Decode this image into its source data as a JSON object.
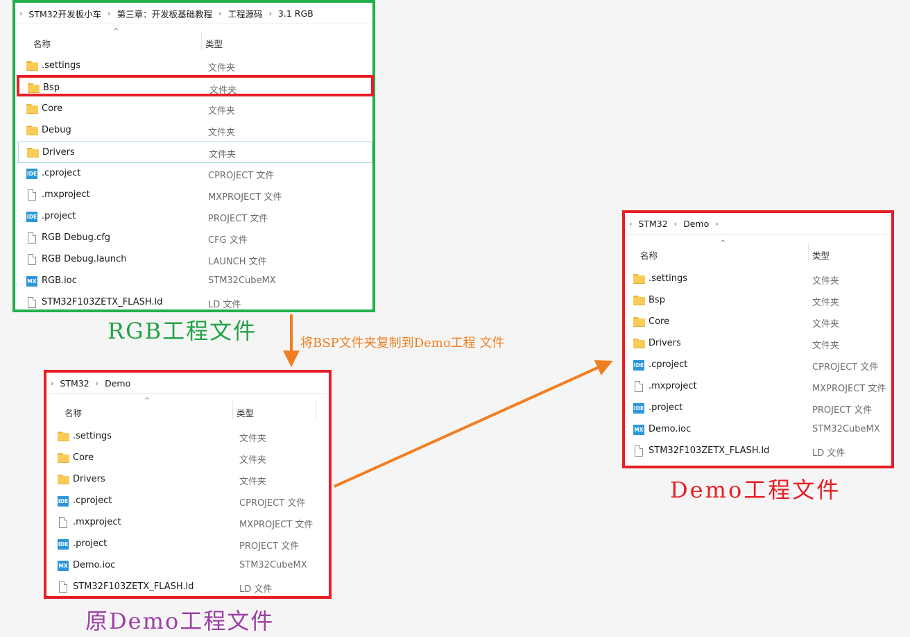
{
  "panel_rgb": {
    "breadcrumb": [
      "STM32开发板小车",
      "第三章：开发板基础教程",
      "工程源码",
      "3.1 RGB"
    ],
    "columns": {
      "name": "名称",
      "type": "类型"
    },
    "files": [
      {
        "name": ".settings",
        "type": "文件夹",
        "icon": "folder-icon"
      },
      {
        "name": "Bsp",
        "type": "文件夹",
        "icon": "folder-icon"
      },
      {
        "name": "Core",
        "type": "文件夹",
        "icon": "folder-icon"
      },
      {
        "name": "Debug",
        "type": "文件夹",
        "icon": "folder-icon"
      },
      {
        "name": "Drivers",
        "type": "文件夹",
        "icon": "folder-icon"
      },
      {
        "name": ".cproject",
        "type": "CPROJECT 文件",
        "icon": "ide-file-icon"
      },
      {
        "name": ".mxproject",
        "type": "MXPROJECT 文件",
        "icon": "file-icon"
      },
      {
        "name": ".project",
        "type": "PROJECT 文件",
        "icon": "ide-file-icon"
      },
      {
        "name": "RGB Debug.cfg",
        "type": "CFG 文件",
        "icon": "file-icon"
      },
      {
        "name": "RGB Debug.launch",
        "type": "LAUNCH 文件",
        "icon": "file-icon"
      },
      {
        "name": "RGB.ioc",
        "type": "STM32CubeMX",
        "icon": "mx-file-icon"
      },
      {
        "name": "STM32F103ZETX_FLASH.ld",
        "type": "LD 文件",
        "icon": "file-icon"
      }
    ]
  },
  "panel_orig": {
    "breadcrumb": [
      "STM32",
      "Demo"
    ],
    "columns": {
      "name": "名称",
      "type": "类型"
    },
    "files": [
      {
        "name": ".settings",
        "type": "文件夹",
        "icon": "folder-icon"
      },
      {
        "name": "Core",
        "type": "文件夹",
        "icon": "folder-icon"
      },
      {
        "name": "Drivers",
        "type": "文件夹",
        "icon": "folder-icon"
      },
      {
        "name": ".cproject",
        "type": "CPROJECT 文件",
        "icon": "ide-file-icon"
      },
      {
        "name": ".mxproject",
        "type": "MXPROJECT 文件",
        "icon": "file-icon"
      },
      {
        "name": ".project",
        "type": "PROJECT 文件",
        "icon": "ide-file-icon"
      },
      {
        "name": "Demo.ioc",
        "type": "STM32CubeMX",
        "icon": "mx-file-icon"
      },
      {
        "name": "STM32F103ZETX_FLASH.ld",
        "type": "LD 文件",
        "icon": "file-icon"
      }
    ]
  },
  "panel_demo": {
    "breadcrumb": [
      "STM32",
      "Demo"
    ],
    "columns": {
      "name": "名称",
      "type": "类型"
    },
    "files": [
      {
        "name": ".settings",
        "type": "文件夹",
        "icon": "folder-icon"
      },
      {
        "name": "Bsp",
        "type": "文件夹",
        "icon": "folder-icon"
      },
      {
        "name": "Core",
        "type": "文件夹",
        "icon": "folder-icon"
      },
      {
        "name": "Drivers",
        "type": "文件夹",
        "icon": "folder-icon"
      },
      {
        "name": ".cproject",
        "type": "CPROJECT 文件",
        "icon": "ide-file-icon"
      },
      {
        "name": ".mxproject",
        "type": "MXPROJECT 文件",
        "icon": "file-icon"
      },
      {
        "name": ".project",
        "type": "PROJECT 文件",
        "icon": "ide-file-icon"
      },
      {
        "name": "Demo.ioc",
        "type": "STM32CubeMX",
        "icon": "mx-file-icon"
      },
      {
        "name": "STM32F103ZETX_FLASH.ld",
        "type": "LD 文件",
        "icon": "file-icon"
      }
    ]
  },
  "badges": {
    "ide": "IDE",
    "mx": "MX"
  },
  "captions": {
    "rgb": "RGB工程文件",
    "copy": "将BSP文件夹复制到Demo工程 文件",
    "orig": "原Demo工程文件",
    "demo": "Demo工程文件"
  },
  "colors": {
    "green_frame": "#22b04b",
    "red_frame": "#e81e25",
    "arrow": "#f07f22",
    "purple_caption": "#9b3fa5"
  }
}
